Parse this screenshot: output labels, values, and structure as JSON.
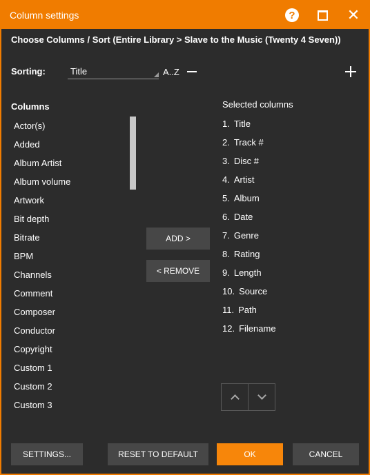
{
  "window": {
    "title": "Column settings",
    "subtitle": "Choose Columns / Sort (Entire Library > Slave to the Music (Twenty 4 Seven))",
    "help_glyph": "?",
    "close_glyph": "✕"
  },
  "sorting": {
    "label": "Sorting:",
    "selected": "Title",
    "order": "A..Z"
  },
  "columns": {
    "heading": "Columns",
    "items": [
      "Actor(s)",
      "Added",
      "Album Artist",
      "Album volume",
      "Artwork",
      "Bit depth",
      "Bitrate",
      "BPM",
      "Channels",
      "Comment",
      "Composer",
      "Conductor",
      "Copyright",
      "Custom 1",
      "Custom 2",
      "Custom 3"
    ]
  },
  "actions": {
    "add": "ADD >",
    "remove": "< REMOVE"
  },
  "selected": {
    "heading": "Selected columns",
    "items": [
      {
        "num": "1.",
        "label": "Title"
      },
      {
        "num": "2.",
        "label": "Track #"
      },
      {
        "num": "3.",
        "label": "Disc #"
      },
      {
        "num": "4.",
        "label": "Artist"
      },
      {
        "num": "5.",
        "label": "Album"
      },
      {
        "num": "6.",
        "label": "Date"
      },
      {
        "num": "7.",
        "label": "Genre"
      },
      {
        "num": "8.",
        "label": "Rating"
      },
      {
        "num": "9.",
        "label": "Length"
      },
      {
        "num": "10.",
        "label": "Source"
      },
      {
        "num": "11.",
        "label": "Path"
      },
      {
        "num": "12.",
        "label": "Filename"
      }
    ]
  },
  "footer": {
    "settings": "SETTINGS...",
    "reset": "RESET TO DEFAULT",
    "ok": "OK",
    "cancel": "CANCEL"
  },
  "colors": {
    "accent": "#f07c00",
    "background": "#2c2c2c",
    "button": "#474747"
  }
}
